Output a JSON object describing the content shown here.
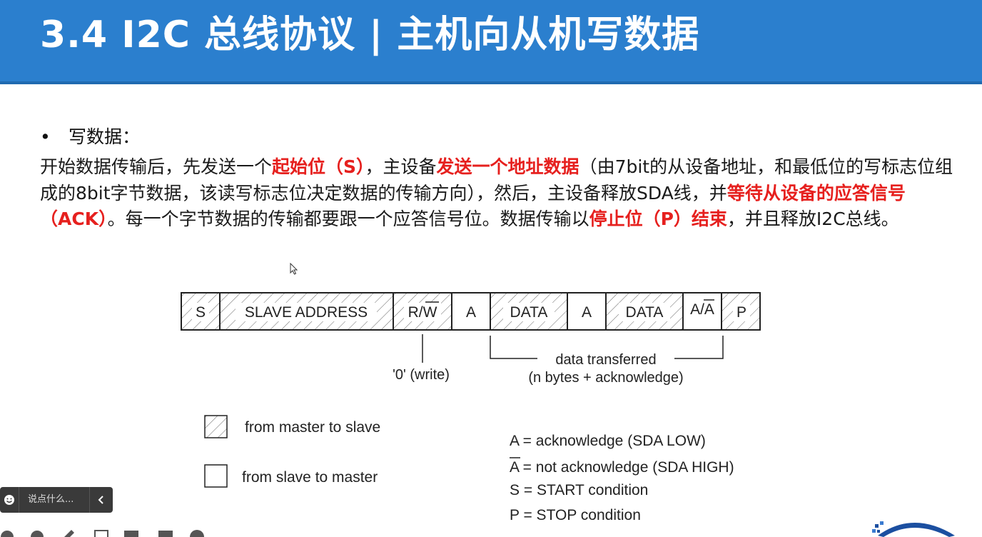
{
  "slide": {
    "title": "3.4 I2C 总线协议 | 主机向从机写数据",
    "bullet": "写数据：",
    "paragraph": [
      {
        "text": "开始数据传输后，先发送一个",
        "highlight": false
      },
      {
        "text": "起始位（S）",
        "highlight": true
      },
      {
        "text": "，主设备",
        "highlight": false
      },
      {
        "text": "发送一个地址数据",
        "highlight": true
      },
      {
        "text": "（由7bit的从设备地址，和最低位的写标志位组成的8bit字节数据，该读写标志位决定数据的传输方向），然后，主设备释放SDA线，并",
        "highlight": false
      },
      {
        "text": "等待从设备的应答信号（ACK）",
        "highlight": true
      },
      {
        "text": "。每一个字节数据的传输都要跟一个应答信号位。数据传输以",
        "highlight": false
      },
      {
        "text": "停止位（P）结束",
        "highlight": true
      },
      {
        "text": "，并且释放I2C总线。",
        "highlight": false
      }
    ]
  },
  "diagram": {
    "cells": [
      {
        "label": "S",
        "hatched": true
      },
      {
        "label": "SLAVE ADDRESS",
        "hatched": true
      },
      {
        "label": "R/W",
        "hatched": true,
        "overline_part": "W"
      },
      {
        "label": "A",
        "hatched": false
      },
      {
        "label": "DATA",
        "hatched": true
      },
      {
        "label": "A",
        "hatched": false
      },
      {
        "label": "DATA",
        "hatched": true
      },
      {
        "label": "A/A",
        "hatched": false,
        "overline_part": "A2"
      },
      {
        "label": "P",
        "hatched": true
      }
    ],
    "write_note": "'0' (write)",
    "transfer_label": "data transferred",
    "transfer_sub": "(n bytes + acknowledge)",
    "legend_master": "from master to slave",
    "legend_slave": "from slave to master",
    "defs": [
      "A = acknowledge (SDA LOW)",
      "A = not acknowledge (SDA HIGH)",
      "S = START condition",
      "P = STOP condition"
    ]
  },
  "chat": {
    "placeholder": "说点什么..."
  },
  "colors": {
    "header": "#2b7fce",
    "highlight": "#e6201e"
  }
}
